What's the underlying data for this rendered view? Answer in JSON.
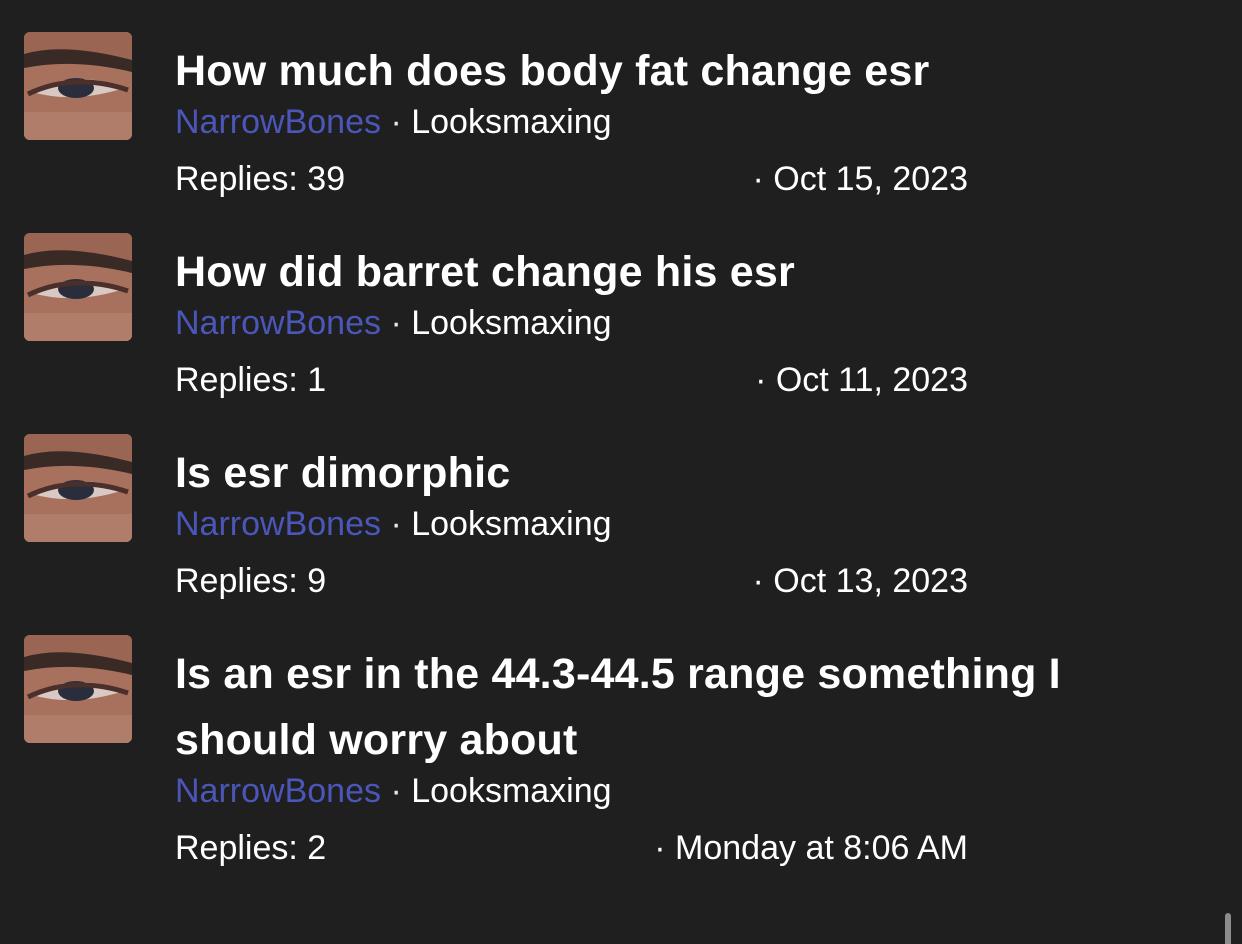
{
  "threads": [
    {
      "title": "How much does body fat change esr",
      "author": "NarrowBones",
      "separator": "·",
      "forum": "Looksmaxing",
      "replies": "Replies: 39",
      "date": "· Oct 15, 2023",
      "avatar_icon": "user-eye-avatar"
    },
    {
      "title": "How did barret change his esr",
      "author": "NarrowBones",
      "separator": "·",
      "forum": "Looksmaxing",
      "replies": "Replies: 1",
      "date": "· Oct 11, 2023",
      "avatar_icon": "user-eye-avatar"
    },
    {
      "title": "Is esr dimorphic",
      "author": "NarrowBones",
      "separator": "·",
      "forum": "Looksmaxing",
      "replies": "Replies: 9",
      "date": "· Oct 13, 2023",
      "avatar_icon": "user-eye-avatar"
    },
    {
      "title": "Is an esr in the 44.3-44.5 range something I should worry about",
      "author": "NarrowBones",
      "separator": "·",
      "forum": "Looksmaxing",
      "replies": "Replies: 2",
      "date": "· Monday at 8:06 AM",
      "avatar_icon": "user-eye-avatar"
    }
  ],
  "colors": {
    "background": "#1f1f1f",
    "author_link": "#4b56b9",
    "text": "#ffffff"
  }
}
